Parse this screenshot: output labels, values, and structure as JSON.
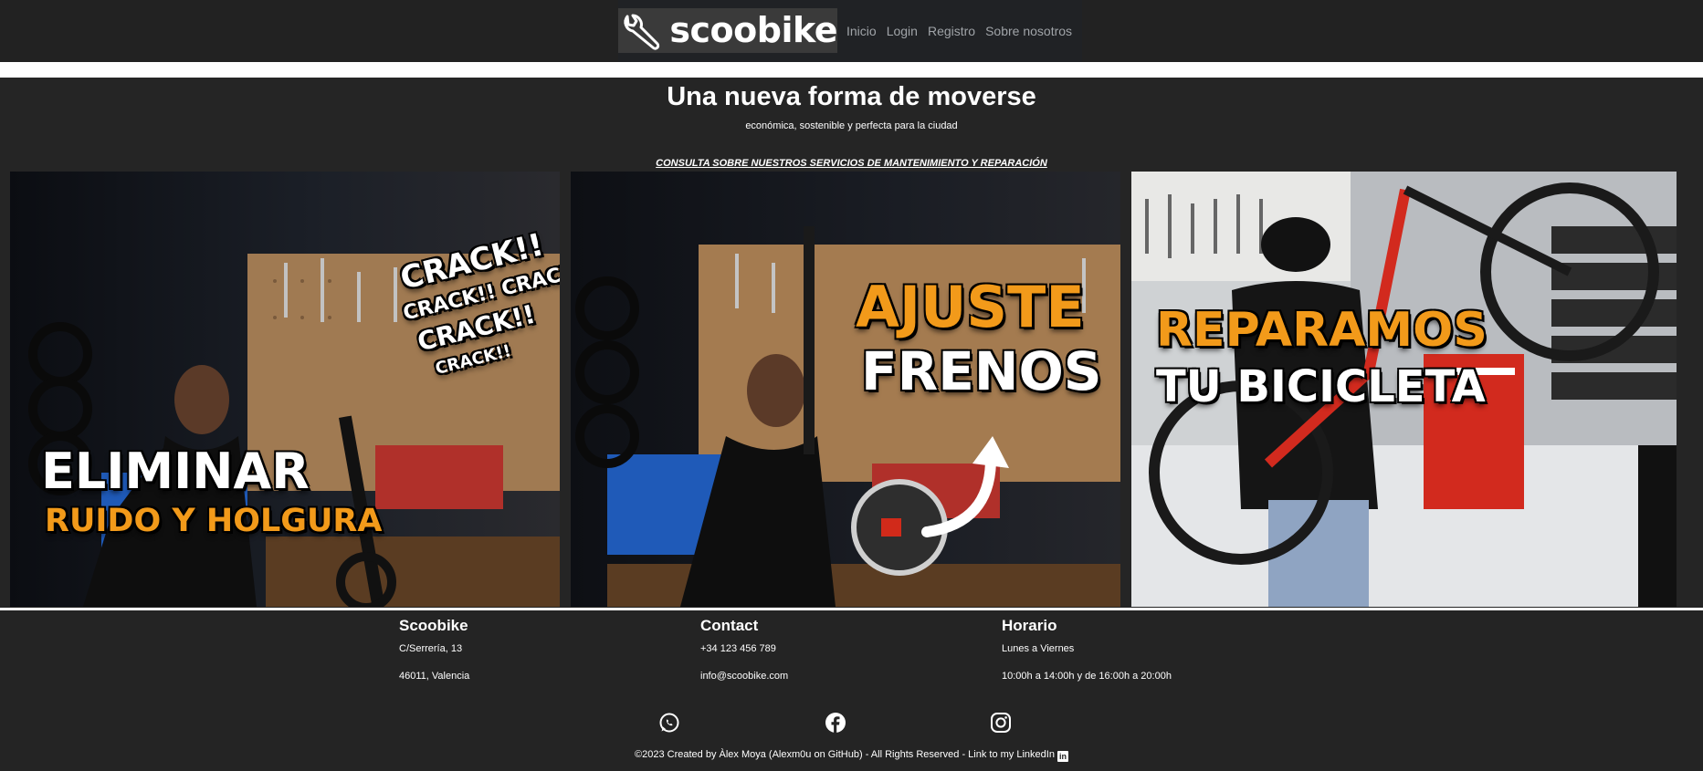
{
  "nav": {
    "brand": "scoobike",
    "links": [
      "Inicio",
      "Login",
      "Registro",
      "Sobre nosotros"
    ]
  },
  "hero": {
    "title": "Una nueva forma de moverse",
    "subtitle": "económica, sostenible y perfecta para la ciudad",
    "services_link": "CONSULTA SOBRE NUESTROS SERVICIOS DE MANTENIMIENTO Y REPARACIÓN"
  },
  "cards": [
    {
      "line1": "ELIMINAR",
      "line2": "RUIDO Y HOLGURA",
      "accent": "CRACK!!",
      "accent2": "CRACK!! CRACK!!",
      "accent3": "CRACK!!",
      "accent4": "CRACK!!"
    },
    {
      "line1": "AJUSTE",
      "line2": "FRENOS"
    },
    {
      "line1": "REPARAMOS",
      "line2": "TU BICICLETA"
    }
  ],
  "footer": {
    "col1": {
      "title": "Scoobike",
      "line1": "C/Serrería, 13",
      "line2": "46011, Valencia"
    },
    "col2": {
      "title": "Contact",
      "line1": "+34 123 456 789",
      "line2": "info@scoobike.com"
    },
    "col3": {
      "title": "Horario",
      "line1": "Lunes a Viernes",
      "line2": "10:00h a 14:00h y de 16:00h a 20:00h"
    },
    "social": [
      "whatsapp-icon",
      "facebook-icon",
      "instagram-icon"
    ],
    "copyright": "©2023 Created by Àlex Moya (Alexm0u on GitHub) - All Rights Reserved - Link to my LinkedIn",
    "linkedin_badge": "in"
  },
  "colors": {
    "background": "#252525",
    "orange_text": "#f29a1a",
    "nav_link": "#a0a4a8"
  }
}
